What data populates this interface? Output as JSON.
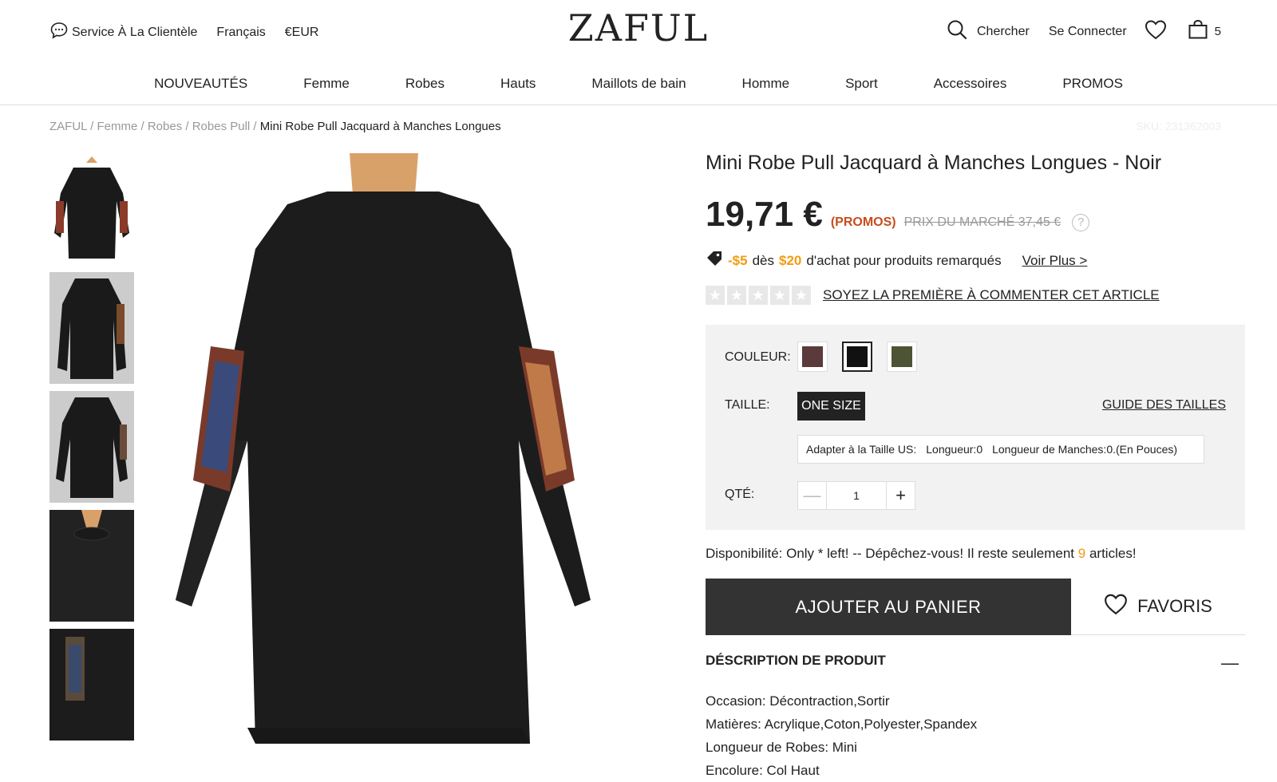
{
  "header": {
    "service_label": "Service À La Clientèle",
    "language": "Français",
    "currency": "€EUR",
    "logo": "ZAFUL",
    "search_label": "Chercher",
    "login_label": "Se Connecter",
    "cart_count": "5"
  },
  "nav": {
    "items": [
      "NOUVEAUTÉS",
      "Femme",
      "Robes",
      "Hauts",
      "Maillots de bain",
      "Homme",
      "Sport",
      "Accessoires",
      "PROMOS"
    ]
  },
  "breadcrumb": {
    "items": [
      "ZAFUL",
      "Femme",
      "Robes",
      "Robes Pull"
    ],
    "current": "Mini Robe Pull Jacquard à Manches Longues",
    "sku": "SKU: 231362003"
  },
  "product": {
    "title": "Mini Robe Pull Jacquard à Manches Longues - Noir",
    "price": "19,71 €",
    "promo": "(PROMOS)",
    "market_price": "PRIX DU MARCHÉ 37,45 €",
    "coupon_discount": "-$5",
    "coupon_from": "dès",
    "coupon_amount": "$20",
    "coupon_text": "d'achat pour produits remarqués",
    "coupon_more": "Voir Plus >",
    "review_link": "SOYEZ LA PREMIÈRE À COMMENTER CET ARTICLE",
    "rating": 0,
    "rating_max": 5
  },
  "options": {
    "color_label": "COULEUR:",
    "colors": [
      "#5a3a3a",
      "#111111",
      "#4d5436"
    ],
    "selected_color": 1,
    "size_label": "TAILLE:",
    "size_value": "ONE SIZE",
    "size_guide": "GUIDE DES TAILLES",
    "fit_label": "Adapter à la Taille US:",
    "fit_length": "Longueur:0",
    "fit_sleeve": "Longueur de Manches:0.(En Pouces)",
    "qty_label": "QTÉ:",
    "qty_value": "1"
  },
  "availability": {
    "prefix": "Disponibilité: Only * left! -- Dépêchez-vous! Il reste seulement",
    "count": "9",
    "suffix": "articles!"
  },
  "actions": {
    "add_to_cart": "AJOUTER AU PANIER",
    "favorites": "FAVORIS"
  },
  "description": {
    "title": "DÉSCRIPTION DE PRODUIT",
    "specs": [
      "Occasion: Décontraction,Sortir",
      "Matières: Acrylique,Coton,Polyester,Spandex",
      "Longueur de Robes: Mini",
      "Encolure: Col Haut"
    ]
  }
}
